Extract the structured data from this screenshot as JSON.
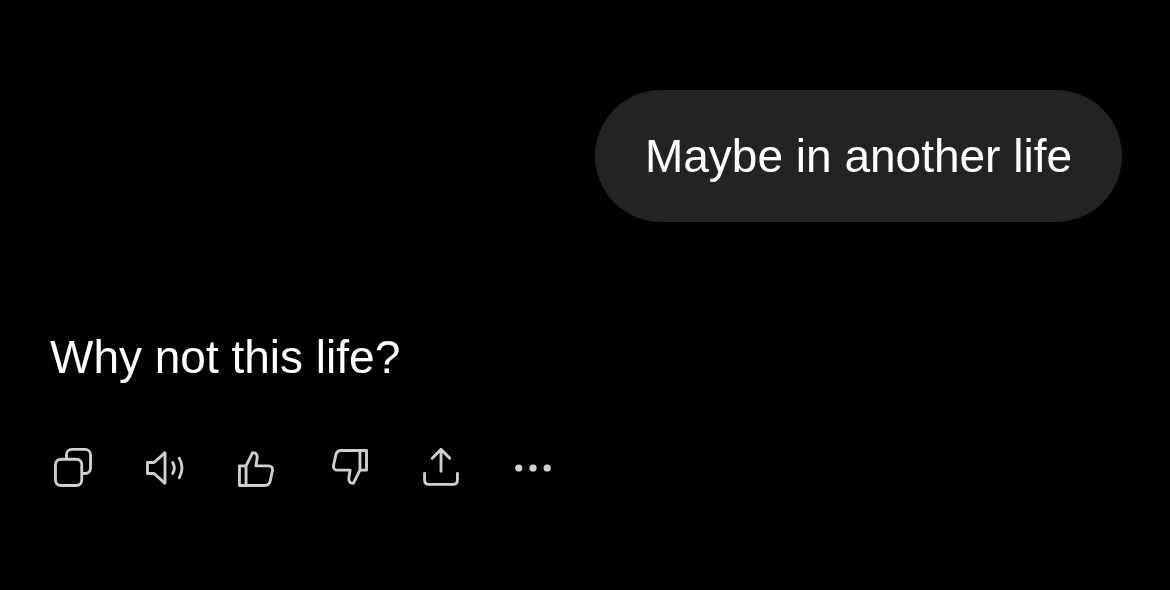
{
  "messages": [
    {
      "kind": "user",
      "text": "Maybe in another life"
    },
    {
      "kind": "assistant",
      "text": "Why not this life?"
    }
  ]
}
